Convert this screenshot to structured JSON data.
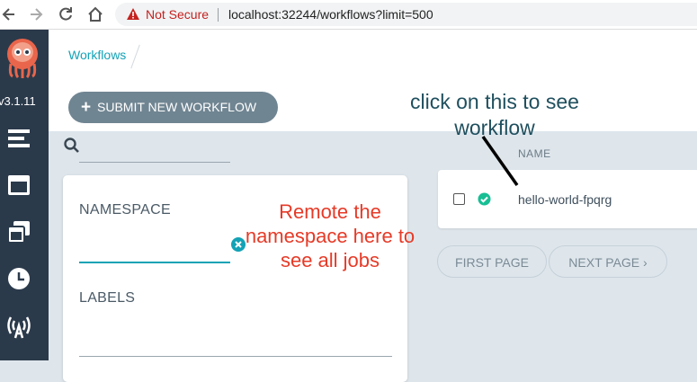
{
  "browser": {
    "back_icon": "arrow-left",
    "forward_icon": "arrow-right",
    "reload_icon": "reload",
    "home_icon": "home",
    "security_label": "Not Secure",
    "url": "localhost:32244/workflows?limit=500"
  },
  "sidebar": {
    "version": "v3.1.11",
    "items": [
      "workflows-icon",
      "workflow-templates-icon",
      "cluster-templates-icon",
      "cron-workflows-icon",
      "event-sources-icon"
    ]
  },
  "breadcrumb": {
    "current": "Workflows"
  },
  "toolbar": {
    "submit_label": "SUBMIT NEW WORKFLOW"
  },
  "filters": {
    "namespace_label": "NAMESPACE",
    "namespace_value": "",
    "labels_label": "LABELS"
  },
  "table": {
    "columns": [
      "NAME"
    ],
    "rows": [
      {
        "name": "hello-world-fpqrg",
        "status": "succeeded"
      }
    ]
  },
  "pagination": {
    "first_label": "FIRST PAGE",
    "next_label": "NEXT PAGE ›"
  },
  "annotations": {
    "workflow_hint": "click on this to see workflow",
    "namespace_hint": "Remote the namespace here to see all jobs"
  },
  "colors": {
    "accent": "#13a2b6",
    "sidebar": "#2b3a4b",
    "annotation_red": "#e63a27",
    "annotation_blue": "#1f4f5e",
    "success": "#18be94"
  }
}
